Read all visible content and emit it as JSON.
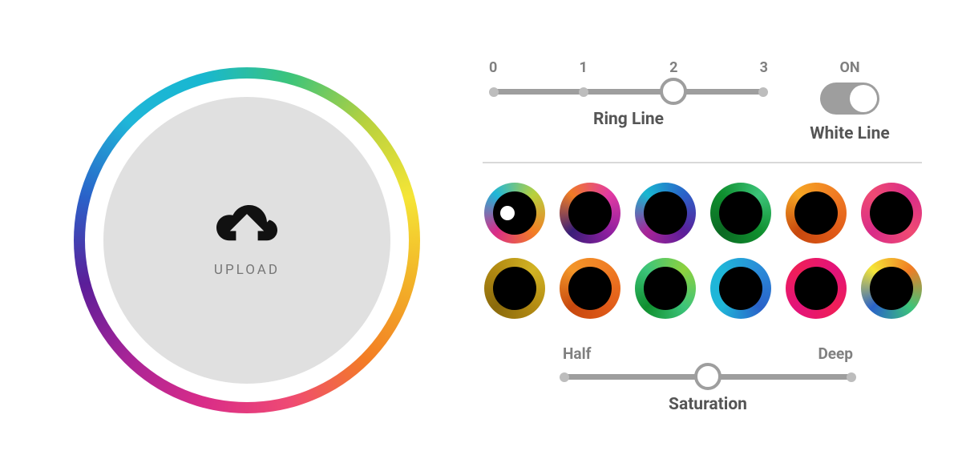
{
  "upload": {
    "label": "UPLOAD"
  },
  "ring_line": {
    "label": "Ring Line",
    "min": 0,
    "max": 3,
    "value": 2,
    "ticks": [
      "0",
      "1",
      "2",
      "3"
    ]
  },
  "white_line": {
    "label": "White Line",
    "on_text": "ON",
    "value": true
  },
  "swatches": [
    {
      "id": "sw-rainbow",
      "a": "#1fb6d8",
      "b": "#b7d13e",
      "c": "#f37d24",
      "d": "#d92c88",
      "selected": true
    },
    {
      "id": "sw-orange-purple",
      "a": "#f07c24",
      "b": "#e33aa2",
      "c": "#8f1fa0",
      "d": "#3a1e78",
      "selected": false
    },
    {
      "id": "sw-teal-purple",
      "a": "#18b7d0",
      "b": "#2a62c9",
      "c": "#5b1e99",
      "d": "#a82497",
      "selected": false
    },
    {
      "id": "sw-green",
      "a": "#0f8f2e",
      "b": "#3cc47a",
      "c": "#0f8f2e",
      "d": "#0b6a23",
      "selected": false
    },
    {
      "id": "sw-orange",
      "a": "#f5a623",
      "b": "#f07c24",
      "c": "#e05a18",
      "d": "#c7480e",
      "selected": false
    },
    {
      "id": "sw-magenta",
      "a": "#ef4a73",
      "b": "#d92c88",
      "c": "#ef4a73",
      "d": "#d92c88",
      "selected": false
    },
    {
      "id": "sw-olive-gold",
      "a": "#b28a12",
      "b": "#d2b324",
      "c": "#b28a12",
      "d": "#8a6a0c",
      "selected": false
    },
    {
      "id": "sw-orange-red",
      "a": "#f29528",
      "b": "#f07c24",
      "c": "#e05a18",
      "d": "#c7480e",
      "selected": false
    },
    {
      "id": "sw-green-lime",
      "a": "#3cc47a",
      "b": "#8ed13e",
      "c": "#3cc47a",
      "d": "#0f8f2e",
      "selected": false
    },
    {
      "id": "sw-blue",
      "a": "#1fb6d8",
      "b": "#2a8bd8",
      "c": "#2a62c9",
      "d": "#1fb6d8",
      "selected": false
    },
    {
      "id": "sw-pink-red",
      "a": "#ef1e58",
      "b": "#e3137a",
      "c": "#ef1e58",
      "d": "#e3137a",
      "selected": false
    },
    {
      "id": "sw-tricolor",
      "a": "#f5e536",
      "b": "#f07c24",
      "c": "#3cc47a",
      "d": "#2a62c9",
      "selected": false
    }
  ],
  "saturation": {
    "label": "Saturation",
    "left": "Half",
    "right": "Deep",
    "value": 0.5
  }
}
